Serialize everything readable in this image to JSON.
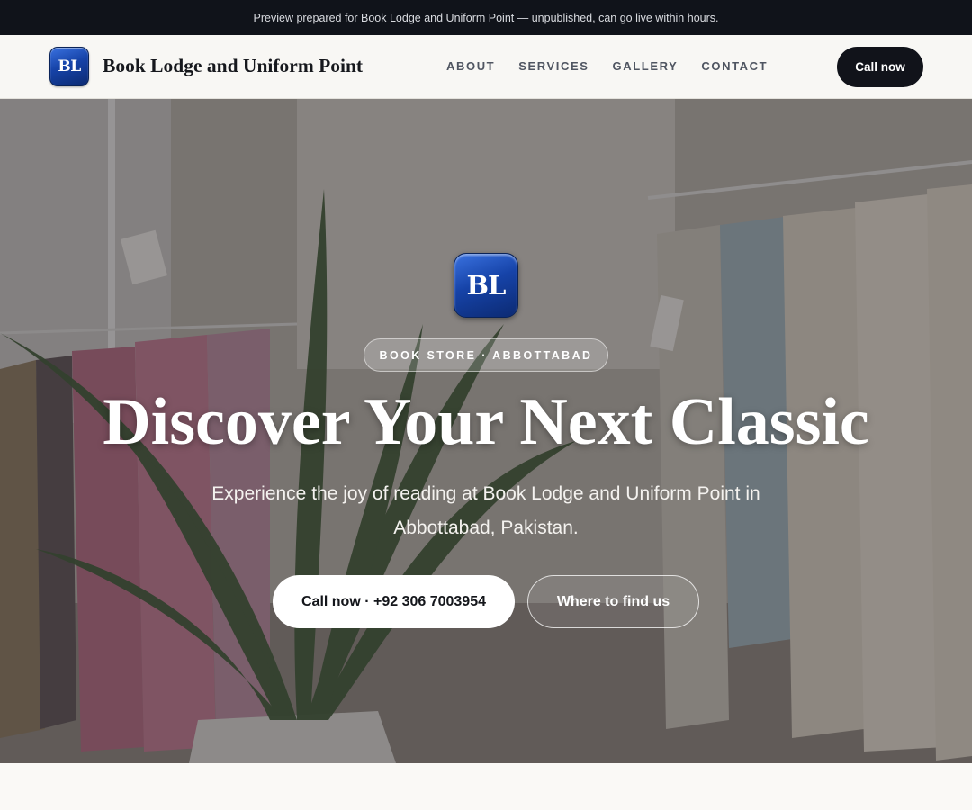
{
  "topbar": {
    "notice": "Preview prepared for Book Lodge and Uniform Point — unpublished, can go live within hours."
  },
  "header": {
    "logo_initials": "BL",
    "brand_name": "Book Lodge and Uniform Point",
    "nav": [
      "ABOUT",
      "SERVICES",
      "GALLERY",
      "CONTACT"
    ],
    "cta_label": "Call now"
  },
  "hero": {
    "logo_initials": "BL",
    "badge": "BOOK STORE · ABBOTTABAD",
    "title": "Discover Your Next Classic",
    "subtitle": "Experience the joy of reading at Book Lodge and Uniform Point in Abbottabad, Pakistan.",
    "primary_cta": "Call now · +92 306 7003954",
    "secondary_cta": "Where to find us",
    "background_description_icon": "clothing-store-photo"
  },
  "colors": {
    "topbar_bg": "#10131a",
    "header_bg": "#f8f7f4",
    "logo_blue": "#1643a8",
    "cta_dark": "#11131a"
  }
}
